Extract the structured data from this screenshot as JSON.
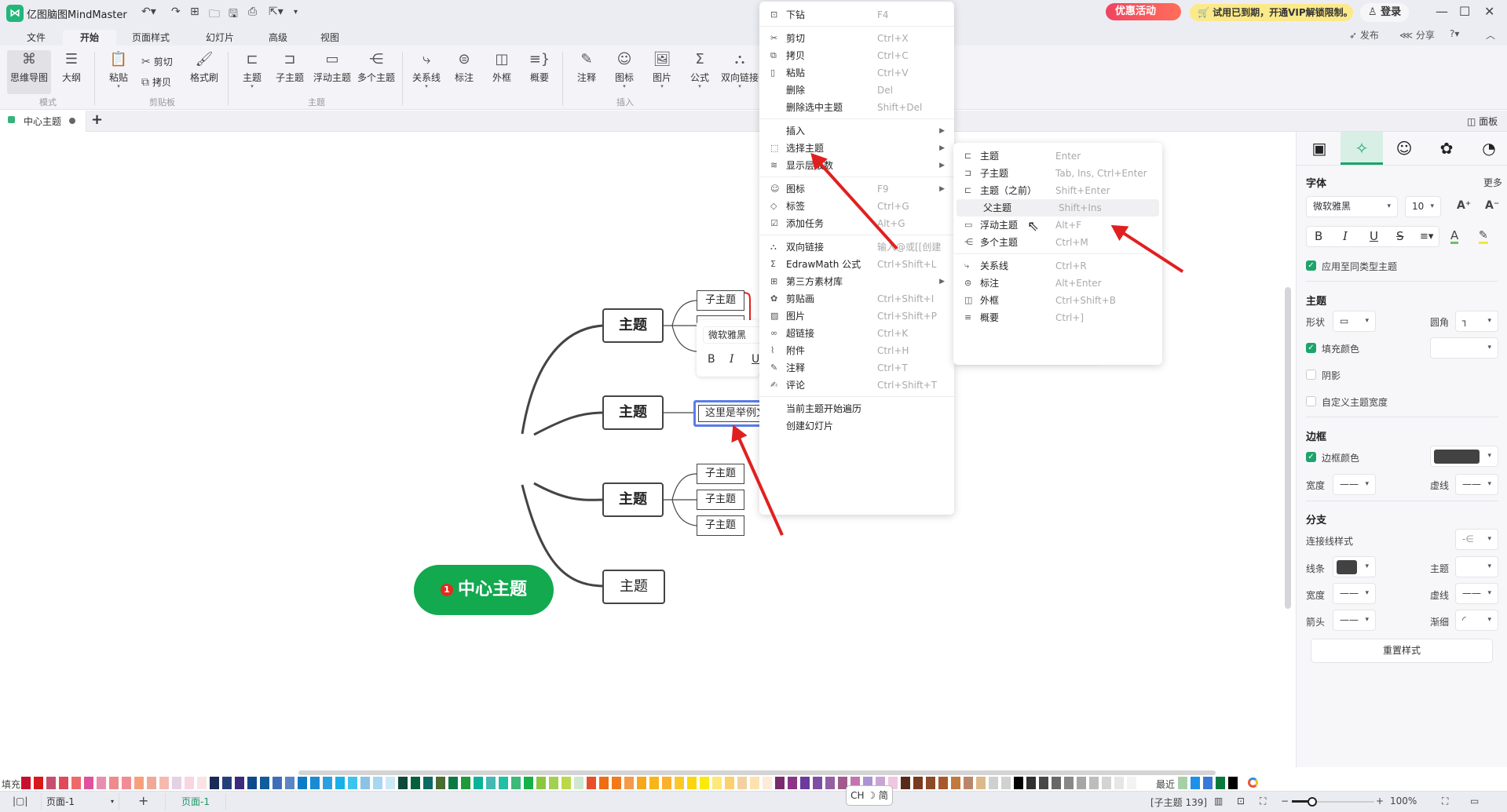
{
  "app": {
    "title": "亿图脑图MindMaster",
    "logo_icon": "mindmaster-logo-icon",
    "quick_access": [
      "undo-icon",
      "redo-icon",
      "new-icon",
      "open-icon",
      "save-icon",
      "print-icon",
      "export-icon",
      "customize-icon"
    ],
    "promo_label": "优惠活动",
    "vip_notice": "试用已到期，开通VIP解锁限制。",
    "login_label": "登录",
    "publish_label": "发布",
    "share_label": "分享"
  },
  "menubar": [
    "文件",
    "开始",
    "页面样式",
    "幻灯片",
    "高级",
    "视图"
  ],
  "menubar_active": "开始",
  "ribbon": {
    "mode": {
      "group": "模式",
      "items": [
        {
          "label": "思维导图",
          "icon": "mindmap-icon"
        },
        {
          "label": "大纲",
          "icon": "outline-icon"
        }
      ]
    },
    "clipboard": {
      "group": "剪贴板",
      "paste": "粘贴",
      "cut": "剪切",
      "copy": "拷贝",
      "format_painter": "格式刷"
    },
    "topic": {
      "group": "主题",
      "items": [
        "主题",
        "子主题",
        "浮动主题",
        "多个主题"
      ]
    },
    "insert": {
      "group": "插入",
      "items": [
        "关系线",
        "标注",
        "外框",
        "概要",
        "注释",
        "图标",
        "图片",
        "公式",
        "双向链接"
      ]
    }
  },
  "doc_tab": {
    "label": "中心主题",
    "add_label": "+",
    "panel_toggle": "面板"
  },
  "canvas": {
    "center": {
      "label": "中心主题",
      "badge": "1"
    },
    "topics": [
      {
        "label": "主题",
        "subtopics": [
          "子主题",
          "子主题"
        ]
      },
      {
        "label": "主题",
        "subtopics": [
          "这里是举例文"
        ]
      },
      {
        "label": "主题",
        "subtopics": [
          "子主题",
          "子主题",
          "子主题"
        ]
      },
      {
        "label": "主题",
        "subtopics": []
      }
    ],
    "mini_toolbar": {
      "font": "微软雅黑",
      "bold": "B",
      "italic": "I",
      "underline": "U"
    }
  },
  "context_menu": {
    "items": [
      {
        "label": "下钻",
        "shortcut": "F4",
        "icon": "drill-down-icon"
      },
      {
        "sep": true
      },
      {
        "label": "剪切",
        "shortcut": "Ctrl+X",
        "icon": "scissors-icon"
      },
      {
        "label": "拷贝",
        "shortcut": "Ctrl+C",
        "icon": "copy-icon"
      },
      {
        "label": "粘贴",
        "shortcut": "Ctrl+V",
        "icon": "clipboard-icon"
      },
      {
        "label": "删除",
        "shortcut": "Del"
      },
      {
        "label": "删除选中主题",
        "shortcut": "Shift+Del"
      },
      {
        "sep": true
      },
      {
        "label": "插入",
        "submenu": true
      },
      {
        "label": "选择主题",
        "submenu": true,
        "icon": "select-topic-icon"
      },
      {
        "label": "显示层级数",
        "submenu": true,
        "icon": "layers-icon"
      },
      {
        "sep": true
      },
      {
        "label": "图标",
        "shortcut": "F9",
        "submenu": true,
        "icon": "emoji-icon"
      },
      {
        "label": "标签",
        "shortcut": "Ctrl+G",
        "icon": "tag-icon"
      },
      {
        "label": "添加任务",
        "shortcut": "Alt+G",
        "icon": "task-icon"
      },
      {
        "sep": true
      },
      {
        "label": "双向链接",
        "shortcut": "输入@或[[创建",
        "icon": "bilink-icon"
      },
      {
        "label": "EdrawMath 公式",
        "shortcut": "Ctrl+Shift+L",
        "icon": "sigma-icon"
      },
      {
        "label": "第三方素材库",
        "submenu": true,
        "icon": "grid-icon"
      },
      {
        "label": "剪贴画",
        "shortcut": "Ctrl+Shift+I",
        "icon": "clipart-icon"
      },
      {
        "label": "图片",
        "shortcut": "Ctrl+Shift+P",
        "icon": "image-icon"
      },
      {
        "label": "超链接",
        "shortcut": "Ctrl+K",
        "icon": "link-icon"
      },
      {
        "label": "附件",
        "shortcut": "Ctrl+H",
        "icon": "paperclip-icon"
      },
      {
        "label": "注释",
        "shortcut": "Ctrl+T",
        "icon": "note-icon"
      },
      {
        "label": "评论",
        "shortcut": "Ctrl+Shift+T",
        "icon": "comment-icon"
      },
      {
        "sep": true
      },
      {
        "label": "当前主题开始遍历"
      },
      {
        "label": "创建幻灯片"
      }
    ]
  },
  "submenu": {
    "items": [
      {
        "label": "主题",
        "shortcut": "Enter",
        "icon": "topic-icon"
      },
      {
        "label": "子主题",
        "shortcut": "Tab, Ins, Ctrl+Enter",
        "icon": "subtopic-icon"
      },
      {
        "label": "主题（之前）",
        "shortcut": "Shift+Enter",
        "icon": "topic-before-icon"
      },
      {
        "label": "父主题",
        "shortcut": "Shift+Ins",
        "highlighted": true
      },
      {
        "label": "浮动主题",
        "shortcut": "Alt+F",
        "icon": "floating-topic-icon"
      },
      {
        "label": "多个主题",
        "shortcut": "Ctrl+M",
        "icon": "multi-topic-icon"
      },
      {
        "sep": true
      },
      {
        "label": "关系线",
        "shortcut": "Ctrl+R",
        "icon": "relationship-icon"
      },
      {
        "label": "标注",
        "shortcut": "Alt+Enter",
        "icon": "callout-icon"
      },
      {
        "label": "外框",
        "shortcut": "Ctrl+Shift+B",
        "icon": "boundary-icon"
      },
      {
        "label": "概要",
        "shortcut": "Ctrl+]",
        "icon": "summary-icon"
      }
    ]
  },
  "right_panel": {
    "tabs": [
      "style-icon",
      "ai-sparkle-icon",
      "emoji-icon",
      "clipart-icon",
      "history-icon"
    ],
    "active_tab": 1,
    "font": {
      "heading": "字体",
      "more": "更多",
      "family": "微软雅黑",
      "size": "10",
      "apply_same": "应用至同类型主题",
      "apply_same_checked": true
    },
    "topic": {
      "heading": "主题",
      "shape_label": "形状",
      "corner_label": "圆角",
      "fill_label": "填充颜色",
      "fill_checked": true,
      "shadow_label": "阴影",
      "shadow_checked": false,
      "custom_width_label": "自定义主题宽度",
      "custom_width_checked": false
    },
    "border": {
      "heading": "边框",
      "color_label": "边框颜色",
      "color_checked": true,
      "color": "#424242",
      "width_label": "宽度",
      "dash_label": "虚线"
    },
    "branch": {
      "heading": "分支",
      "connector_label": "连接线样式",
      "line_label": "线条",
      "line_color": "#424242",
      "topic_label": "主题",
      "width_label": "宽度",
      "dash_label": "虚线",
      "arrow_label": "箭头",
      "taper_label": "渐细"
    },
    "reset_label": "重置样式"
  },
  "palette": {
    "label": "填充",
    "colors": [
      "#c8102e",
      "#d7191c",
      "#c94d6f",
      "#e04b5a",
      "#ee6a6a",
      "#e0529c",
      "#e88fb0",
      "#ef8b8b",
      "#f28b95",
      "#f7a17c",
      "#f0a996",
      "#f6b9b0",
      "#e6d0e4",
      "#f9d5e0",
      "#fbe3e3",
      "#1b2a55",
      "#23407a",
      "#3e2a7a",
      "#0d4a8c",
      "#135c9c",
      "#3f6eb8",
      "#5a86c4",
      "#0d7cc7",
      "#1a8ad3",
      "#2aa0e0",
      "#19b0e9",
      "#3cc4ef",
      "#8cc1e8",
      "#a7d6f0",
      "#cde8f5",
      "#0e4a3a",
      "#05613d",
      "#0d6a63",
      "#4a6b32",
      "#0c7a47",
      "#1f9a3a",
      "#0ab39a",
      "#45b8b3",
      "#20c0a4",
      "#3db97a",
      "#18b04a",
      "#8cc63f",
      "#a0d150",
      "#bad84a",
      "#cfe7d0",
      "#e8502a",
      "#ef6c12",
      "#f27a1a",
      "#f49a4a",
      "#f4a81a",
      "#f8b51a",
      "#fbb12e",
      "#fcc728",
      "#fbd60a",
      "#fce80e",
      "#fde878",
      "#fcd06a",
      "#f3d19e",
      "#fde2b0",
      "#fcebd8",
      "#7b2a6e",
      "#8b3589",
      "#6a3a9c",
      "#7e4ea4",
      "#9460a4",
      "#a05a8c",
      "#c573b0",
      "#ab93d3",
      "#c8a5d3",
      "#efc7e2",
      "#5a2a18",
      "#7a3a20",
      "#8d4a28",
      "#a8592c",
      "#c07a3c",
      "#b8876a",
      "#dcb98c",
      "#d0d0d0",
      "#cfd3d0",
      "#000000",
      "#303030",
      "#484848",
      "#686868",
      "#888888",
      "#a6a6a6",
      "#bdbdbd",
      "#d4d4d4",
      "#e6e6e6",
      "#f3f3f3"
    ],
    "recent_label": "最近",
    "recent": [
      "#a8d0a8",
      "#1e90e8",
      "#3a78d8",
      "#057a3c",
      "#000000"
    ]
  },
  "statusbar": {
    "page_select": "页面-1",
    "add_page": "+",
    "page_tab": "页面-1",
    "ime": "CH ☽ 简",
    "selection": "[子主题 139]",
    "zoom_label": "100%",
    "zoom_value_percent": 100,
    "zoom_minus": "−",
    "zoom_plus": "+"
  }
}
